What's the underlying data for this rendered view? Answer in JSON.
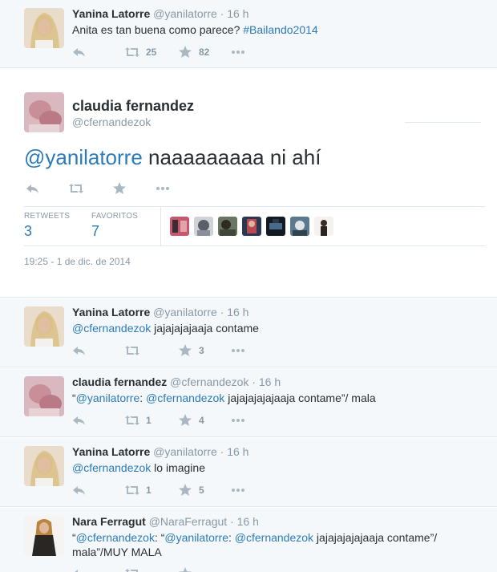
{
  "tweets_before": [
    {
      "name": "Yanina Latorre",
      "handle": "@yanilatorre",
      "time": "16 h",
      "text_plain": "Anita es tan buena como parece? ",
      "hashtag": "#Bailando2014",
      "retweets": "25",
      "favorites": "82"
    }
  ],
  "main_tweet": {
    "name": "claudia fernandez",
    "handle": "@cfernandezok",
    "mention": "@yanilatorre",
    "text": " naaaaaaaaa ni ahí",
    "stats": {
      "retweets_label": "RETWEETS",
      "retweets": "3",
      "favorites_label": "FAVORITOS",
      "favorites": "7"
    },
    "date": "19:25 - 1 de dic. de 2014"
  },
  "replies": [
    {
      "name": "Yanina Latorre",
      "handle": "@yanilatorre",
      "time": "16 h",
      "line1_mention": "@cfernandezok",
      "line1_text": " jajajajajaaja contame",
      "retweets": "",
      "favorites": "3"
    },
    {
      "name": "claudia fernandez",
      "handle": "@cfernandezok",
      "time": "16 h",
      "q_open": "“",
      "m1": "@yanilatorre",
      "colon": ": ",
      "m2": "@cfernandezok",
      "rest": " jajajajajajaaja contame”/ mala",
      "retweets": "1",
      "favorites": "4"
    },
    {
      "name": "Yanina Latorre",
      "handle": "@yanilatorre",
      "time": "16 h",
      "line1_mention": "@cfernandezok",
      "line1_text": " lo imagine",
      "retweets": "1",
      "favorites": "5"
    },
    {
      "name": "Nara Ferragut",
      "handle": "@NaraFerragut",
      "time": "16 h",
      "q1": "“",
      "m1": "@cfernandezok",
      "c1": ": “",
      "m2": "@yanilatorre",
      "c2": ": ",
      "m3": "@cfernandezok",
      "rest1": " jajajajajajaaja contame”/",
      "line2": "mala”/MUY MALA"
    }
  ],
  "separator": "·",
  "icons": {
    "reply": "reply-icon",
    "retweet": "retweet-icon",
    "favorite": "star-icon",
    "more": "more-icon"
  },
  "colors": {
    "link": "#2b7bb9",
    "muted": "#8899a6",
    "icon": "#aab8c2",
    "stream_bg": "#f5f8fa"
  }
}
